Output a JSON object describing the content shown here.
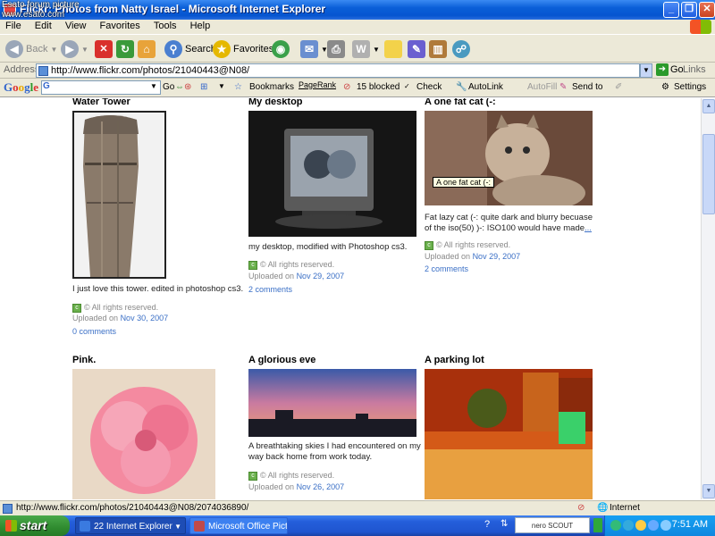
{
  "overlay": {
    "line1": "Esato forum picture",
    "line2": "www.esato.com"
  },
  "window": {
    "title": "Flickr: Photos from Natty Israel - Microsoft Internet Explorer"
  },
  "menu": [
    "File",
    "Edit",
    "View",
    "Favorites",
    "Tools",
    "Help"
  ],
  "toolbar": {
    "back": "Back",
    "search": "Search",
    "favorites": "Favorites"
  },
  "address": {
    "label": "Address",
    "url": "http://www.flickr.com/photos/21040443@N08/",
    "go": "Go",
    "links": "Links"
  },
  "google_toolbar": {
    "logo": "Google",
    "go": "Go",
    "bookmarks": "Bookmarks",
    "pagerank": "PageRank",
    "blocked": "15 blocked",
    "check": "Check",
    "autolink": "AutoLink",
    "autofill": "AutoFill",
    "sendto": "Send to",
    "settings": "Settings"
  },
  "photos": [
    {
      "title": "Water Tower",
      "description": "I just love this tower. edited in photoshop cs3.",
      "rights": "© All rights reserved.",
      "uploaded_label": "Uploaded on",
      "date": "Nov 30, 2007",
      "comments": "0 comments"
    },
    {
      "title": "My desktop",
      "description": "my desktop, modified with Photoshop cs3.",
      "rights": "© All rights reserved.",
      "uploaded_label": "Uploaded on",
      "date": "Nov 29, 2007",
      "comments": "2 comments"
    },
    {
      "title": "A one fat cat (-:",
      "tooltip": "A one fat cat (-:",
      "description": "Fat lazy cat (-: quite dark and blurry becuase of the iso(50) )-: ISO100 would have made",
      "more": "...",
      "rights": "© All rights reserved.",
      "uploaded_label": "Uploaded on",
      "date": "Nov 29, 2007",
      "comments": "2 comments"
    },
    {
      "title": "Pink."
    },
    {
      "title": "A glorious eve",
      "description": "A breathtaking skies I had encountered on my way back home from work today.",
      "rights": "© All rights reserved.",
      "uploaded_label": "Uploaded on",
      "date": "Nov 26, 2007"
    },
    {
      "title": "A parking lot"
    }
  ],
  "status": {
    "text": "http://www.flickr.com/photos/21040443@N08/2074036890/",
    "zone": "Internet"
  },
  "taskbar": {
    "start": "start",
    "tasks": [
      "22 Internet Explorer",
      "Microsoft Office Pictu..."
    ],
    "nero": "nero SCOUT",
    "clock": "7:51 AM"
  }
}
